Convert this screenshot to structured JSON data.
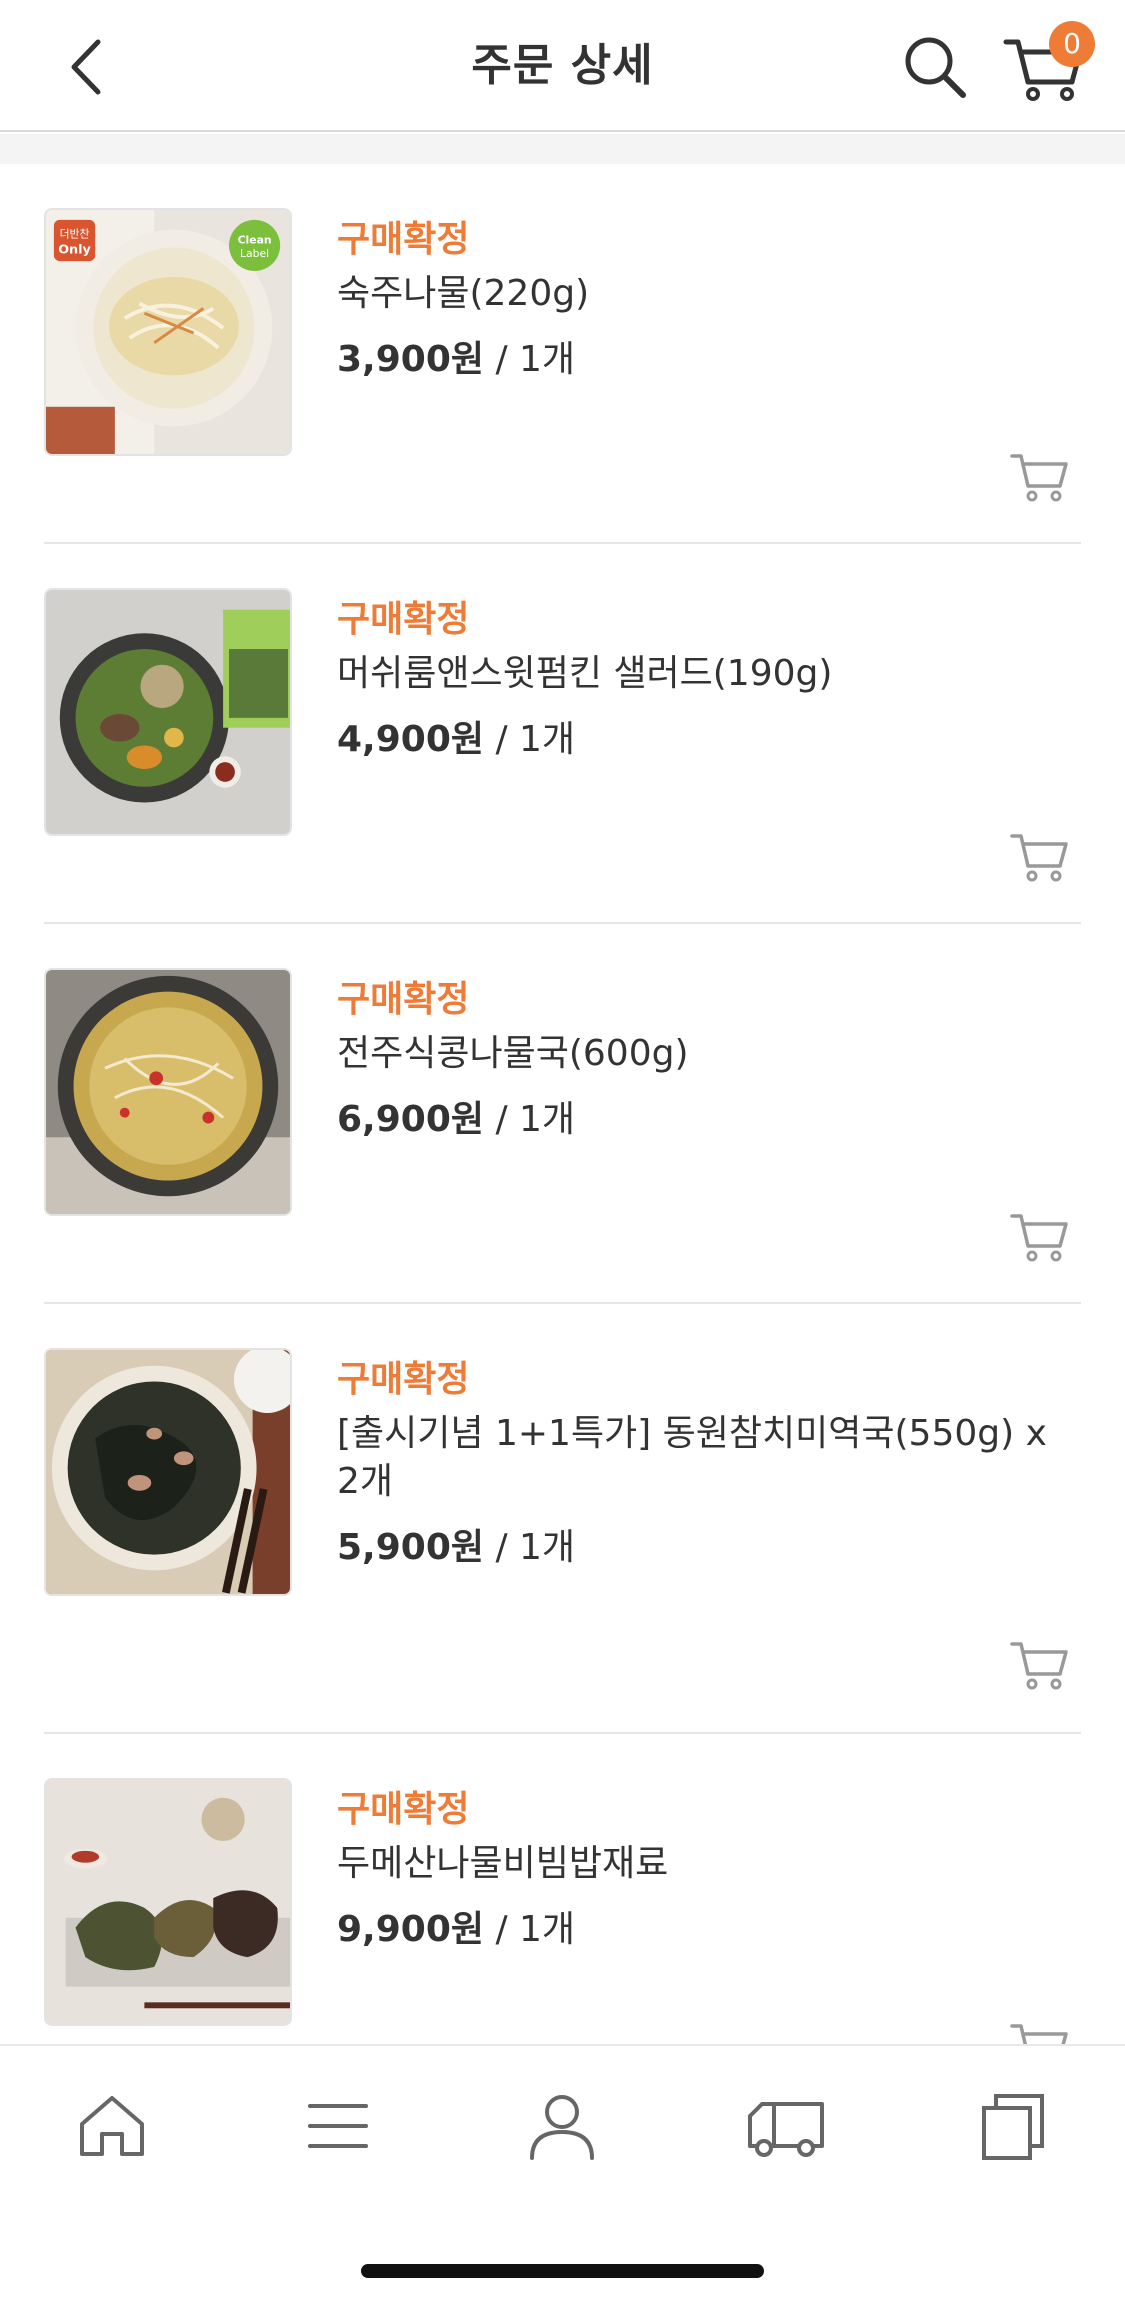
{
  "header": {
    "title": "주문 상세",
    "cart_count": "0"
  },
  "items": [
    {
      "status": "구매확정",
      "name": "숙주나물(220g)",
      "price": "3,900원",
      "qty": " / 1개"
    },
    {
      "status": "구매확정",
      "name": "머쉬룸앤스윗펌킨 샐러드(190g)",
      "price": "4,900원",
      "qty": " / 1개"
    },
    {
      "status": "구매확정",
      "name": "전주식콩나물국(600g)",
      "price": "6,900원",
      "qty": " / 1개"
    },
    {
      "status": "구매확정",
      "name": "[출시기념 1+1특가] 동원참치미역국(550g) x 2개",
      "price": "5,900원",
      "qty": " / 1개"
    },
    {
      "status": "구매확정",
      "name": "두메산나물비빔밥재료",
      "price": "9,900원",
      "qty": " / 1개"
    }
  ],
  "thumb_badges": {
    "only_top": "더반찬",
    "only_bottom": "Only",
    "clean_top": "Clean",
    "clean_bottom": "Label"
  },
  "icons": {
    "back": "chevron-left-icon",
    "search": "search-icon",
    "cart": "cart-icon",
    "add_to_cart": "cart-outline-icon",
    "tab_home": "home-icon",
    "tab_menu": "menu-icon",
    "tab_account": "user-icon",
    "tab_delivery": "truck-icon",
    "tab_recent": "recent-items-icon"
  },
  "colors": {
    "accent": "#ee7b36",
    "text": "#333333",
    "divider": "#e6e6e6"
  }
}
